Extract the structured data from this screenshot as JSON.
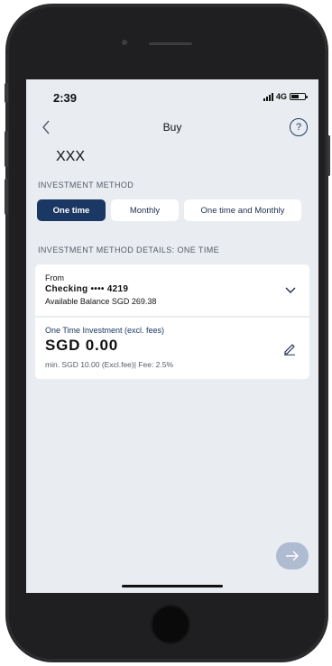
{
  "status": {
    "time": "2:39",
    "network": "4G"
  },
  "nav": {
    "title": "Buy",
    "help_symbol": "?"
  },
  "fund": {
    "name": "XXX"
  },
  "investment_method": {
    "label": "INVESTMENT METHOD",
    "options": [
      "One time",
      "Monthly",
      "One time and Monthly"
    ],
    "selected": "One time"
  },
  "details": {
    "label": "INVESTMENT METHOD DETAILS: ONE TIME"
  },
  "from_account": {
    "label": "From",
    "account": "Checking •••• 4219",
    "balance": "Available Balance SGD 269.38"
  },
  "amount": {
    "label": "One Time Investment (excl. fees)",
    "value": "SGD  0.00",
    "note": "min. SGD 10.00 (Excl.fee)| Fee: 2.5%"
  },
  "icons": {
    "back": "chevron-left-icon",
    "help": "question-circle-icon",
    "dropdown": "chevron-down-icon",
    "edit": "pencil-icon",
    "next": "arrow-right-icon"
  },
  "colors": {
    "primary": "#1b3763",
    "screen_background": "#e9ecf1",
    "next_button_disabled": "#aebbd0"
  }
}
